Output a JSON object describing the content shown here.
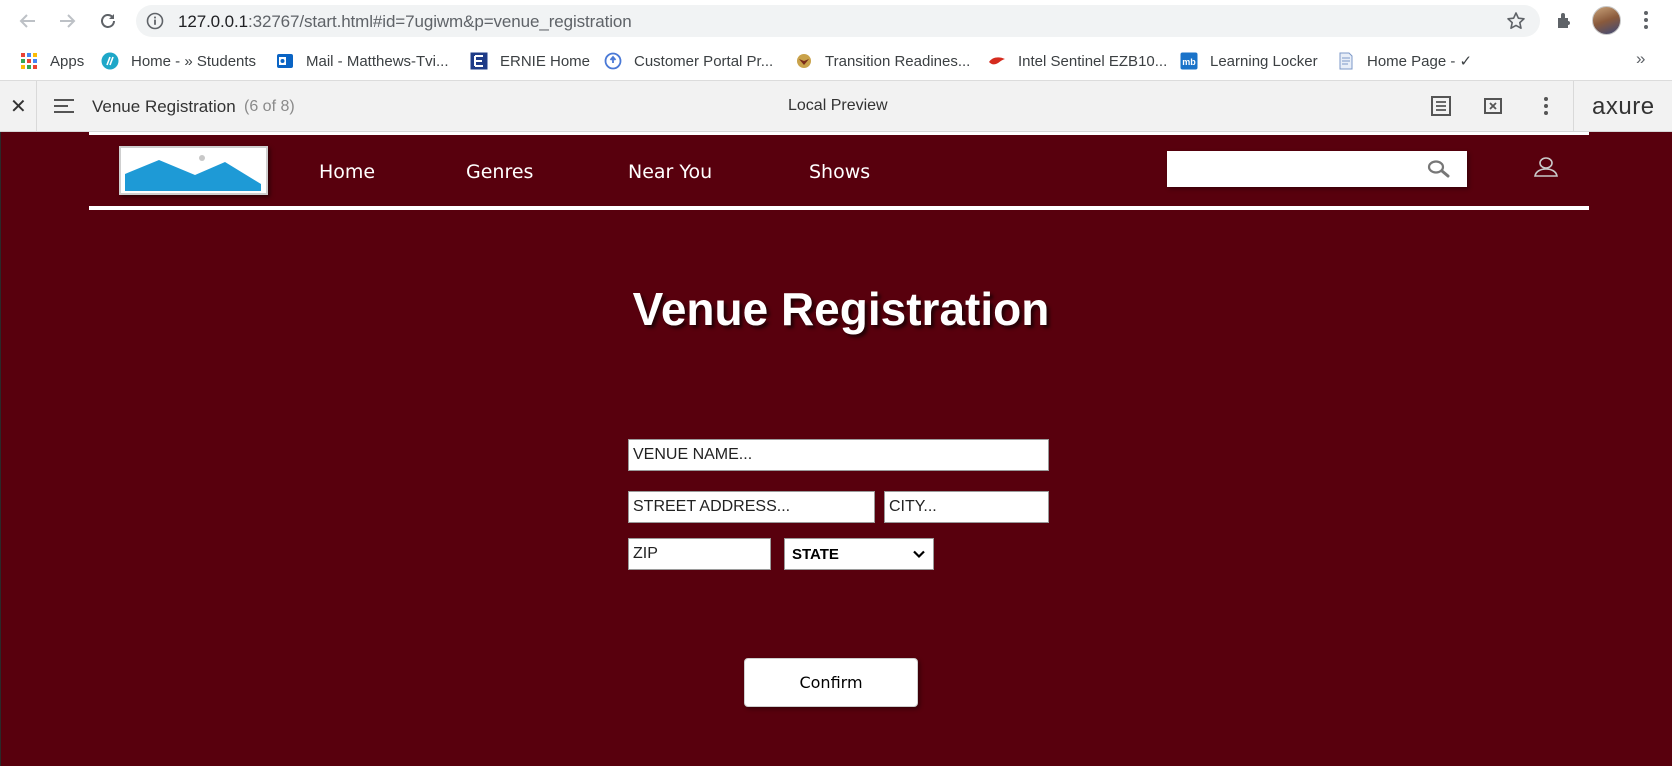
{
  "browser": {
    "url_host": "127.0.0.1",
    "url_rest": ":32767/start.html#id=7ugiwm&p=venue_registration",
    "bookmarks": [
      {
        "label": "Apps",
        "icon": "apps-grid-icon"
      },
      {
        "label": "Home - » Students",
        "icon": "students-icon"
      },
      {
        "label": "Mail - Matthews-Tvi...",
        "icon": "outlook-icon"
      },
      {
        "label": "ERNIE Home",
        "icon": "ernie-icon"
      },
      {
        "label": "Customer Portal Pr...",
        "icon": "portal-icon"
      },
      {
        "label": "Transition Readines...",
        "icon": "transition-icon"
      },
      {
        "label": "Intel Sentinel EZB10...",
        "icon": "intel-icon"
      },
      {
        "label": "Learning Locker",
        "icon": "learning-locker-icon"
      },
      {
        "label": "Home Page - ✓",
        "icon": "document-icon"
      }
    ],
    "bookmarks_more": "»"
  },
  "axure": {
    "page_title": "Venue Registration",
    "page_count": "(6 of 8)",
    "center_label": "Local Preview",
    "logo_text": "axure"
  },
  "site": {
    "nav": [
      "Home",
      "Genres",
      "Near You",
      "Shows"
    ],
    "search": {
      "value": "",
      "placeholder": ""
    },
    "title": "Venue Registration",
    "form": {
      "venue_name_placeholder": "VENUE NAME...",
      "street_placeholder": "STREET ADDRESS...",
      "city_placeholder": "CITY...",
      "zip_placeholder": "ZIP",
      "state_selected": "STATE",
      "confirm_label": "Confirm"
    }
  },
  "colors": {
    "page_background": "#58000d",
    "logo_blue": "#1e9ad6",
    "chrome_omnibox": "#f1f3f4"
  }
}
